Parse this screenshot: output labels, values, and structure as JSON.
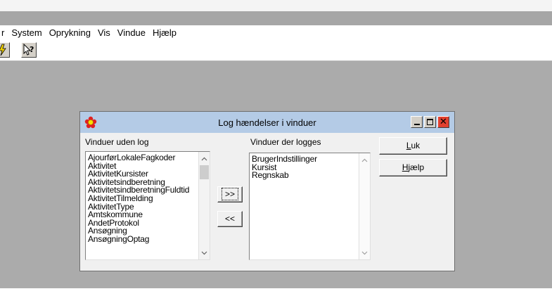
{
  "menubar": {
    "items": [
      {
        "label": "r"
      },
      {
        "label": "System"
      },
      {
        "label": "Oprykning"
      },
      {
        "label": "Vis"
      },
      {
        "label": "Vindue"
      },
      {
        "label": "Hjælp"
      }
    ]
  },
  "toolbar": {
    "buttons": [
      {
        "icon": "lightning-icon",
        "glyph": "ϟ"
      },
      {
        "icon": "help-pointer-icon",
        "glyph": "?"
      }
    ]
  },
  "dialog": {
    "title": "Log hændelser i vinduer",
    "left_list": {
      "label": "Vinduer uden log",
      "items": [
        "AjourførLokaleFagkoder",
        "Aktivitet",
        "AktivitetKursister",
        "Aktivitetsindberetning",
        "AktivitetsindberetningFuldtid",
        "AktivitetTilmelding",
        "AktivitetType",
        "Amtskommune",
        "AndetProtokol",
        "Ansøgning",
        "AnsøgningOptag"
      ]
    },
    "right_list": {
      "label": "Vinduer der logges",
      "items": [
        "BrugerIndstillinger",
        "Kursist",
        "Regnskab"
      ]
    },
    "buttons": {
      "add": ">>",
      "remove": "<<",
      "close_mnemonic": "L",
      "close_rest": "uk",
      "help_mnemonic": "H",
      "help_rest": "jælp"
    }
  }
}
